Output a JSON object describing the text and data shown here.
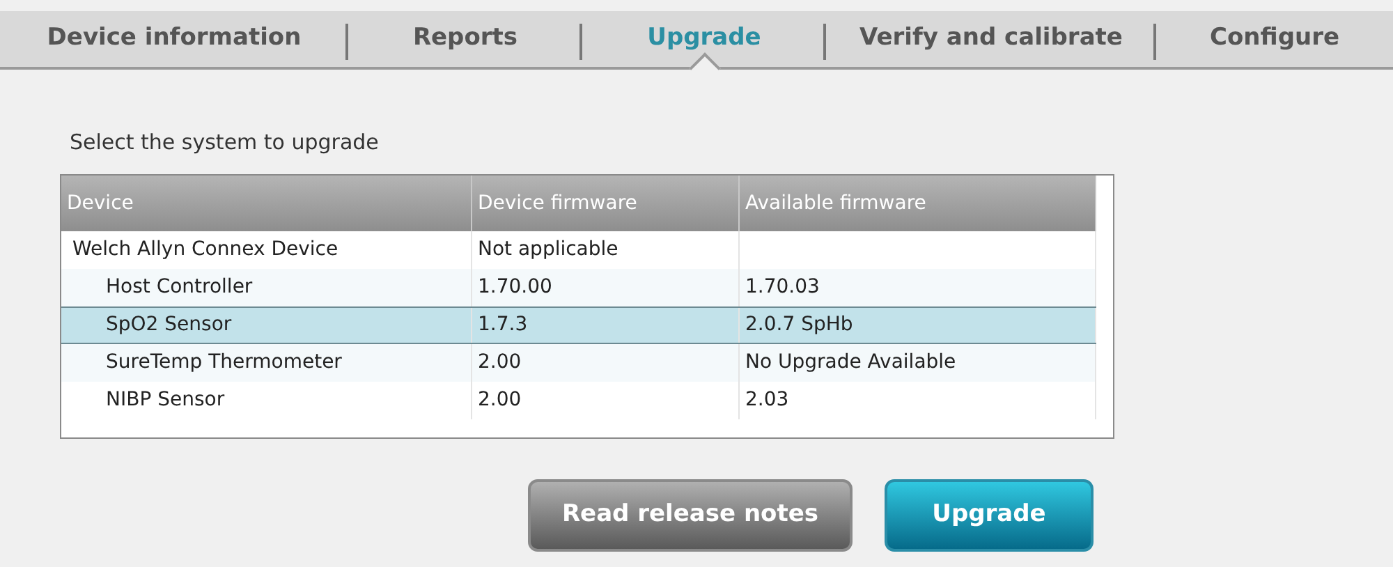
{
  "tabs": [
    {
      "label": "Device information",
      "selected": false
    },
    {
      "label": "Reports",
      "selected": false
    },
    {
      "label": "Upgrade",
      "selected": true
    },
    {
      "label": "Verify and calibrate",
      "selected": false
    },
    {
      "label": "Configure",
      "selected": false
    }
  ],
  "prompt": "Select the system to upgrade",
  "table": {
    "columns": [
      "Device",
      "Device firmware",
      "Available firmware"
    ],
    "rows": [
      {
        "cells": [
          "Welch Allyn Connex Device",
          "Not applicable",
          ""
        ],
        "selected": false,
        "children": [
          {
            "cells": [
              "Host Controller",
              "1.70.00",
              "1.70.03"
            ],
            "selected": false
          },
          {
            "cells": [
              "SpO2 Sensor",
              "1.7.3",
              "2.0.7 SpHb"
            ],
            "selected": true
          },
          {
            "cells": [
              "SureTemp Thermometer",
              "2.00",
              "No Upgrade Available"
            ],
            "selected": false
          },
          {
            "cells": [
              "NIBP Sensor",
              "2.00",
              "2.03"
            ],
            "selected": false
          }
        ]
      }
    ]
  },
  "buttons": [
    {
      "label": "Read release notes",
      "kind": "secondary"
    },
    {
      "label": "Upgrade",
      "kind": "primary"
    }
  ]
}
